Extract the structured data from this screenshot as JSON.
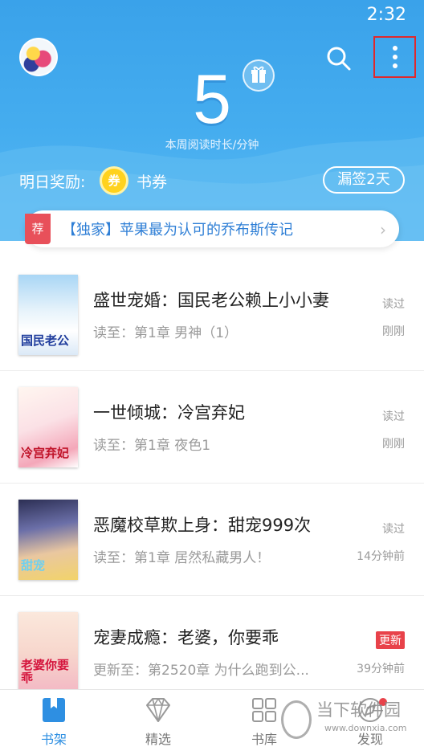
{
  "status_bar": {
    "time": "2:32"
  },
  "header": {
    "weekly_minutes": "5",
    "weekly_label": "本周阅读时长/分钟",
    "reward_label": "明日奖励:",
    "coupon_icon_char": "券",
    "reward_value": "书券",
    "missed_button": "漏签2天"
  },
  "banner": {
    "tag": "荐",
    "text": "【独家】苹果最为认可的乔布斯传记",
    "arrow": "›"
  },
  "books": [
    {
      "title": "盛世宠婚：国民老公赖上小小妻",
      "progress": "读至：第1章 男神（1）",
      "status": "读过",
      "time": "刚刚",
      "cover_text": "国民老公",
      "badge": ""
    },
    {
      "title": "一世倾城：冷宫弃妃",
      "progress": "读至：第1章 夜色1",
      "status": "读过",
      "time": "刚刚",
      "cover_text": "冷宫弃妃",
      "badge": ""
    },
    {
      "title": "恶魔校草欺上身：甜宠999次",
      "progress": "读至：第1章 居然私藏男人！",
      "status": "读过",
      "time": "14分钟前",
      "cover_text": "甜宠",
      "badge": ""
    },
    {
      "title": "宠妻成瘾：老婆，你要乖",
      "progress": "更新至：第2520章 为什么跑到公...",
      "status": "",
      "time": "39分钟前",
      "cover_text": "老婆你要乖",
      "badge": "更新"
    }
  ],
  "nav": [
    {
      "label": "书架",
      "icon": "bookshelf-icon",
      "active": true
    },
    {
      "label": "精选",
      "icon": "diamond-icon",
      "active": false
    },
    {
      "label": "书库",
      "icon": "grid-icon",
      "active": false
    },
    {
      "label": "发现",
      "icon": "compass-icon",
      "active": false
    }
  ],
  "watermark": {
    "text": "当下软件园",
    "url": "www.downxia.com"
  },
  "colors": {
    "accent": "#2e8fe2",
    "header": "#45adef",
    "badge": "#e8424a",
    "highlight_box": "#e0282c"
  }
}
